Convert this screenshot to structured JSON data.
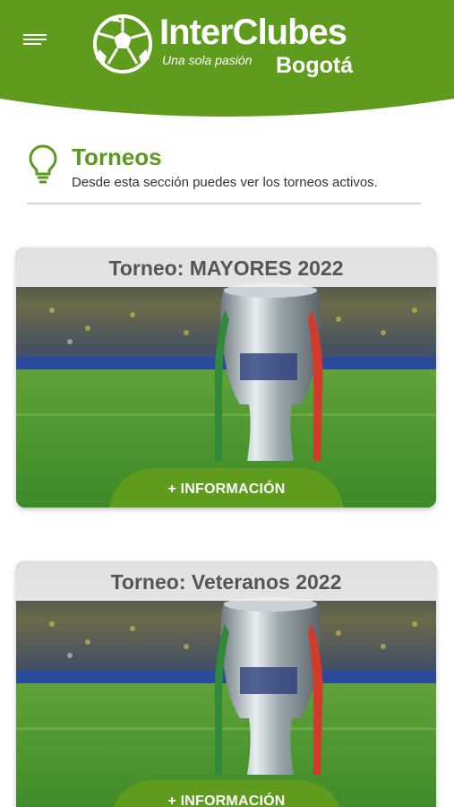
{
  "header": {
    "menu_icon": "hamburger-menu-icon",
    "brand_title": "InterClubes",
    "brand_slogan": "Una sola pasión",
    "brand_city": "Bogotá",
    "accent_color": "#5f9b1c"
  },
  "section": {
    "icon": "lightbulb-icon",
    "title": "Torneos",
    "description": "Desde esta sección puedes ver los torneos activos."
  },
  "tournaments": [
    {
      "title": "Torneo: MAYORES 2022",
      "button_label": "+ INFORMACIÓN",
      "image": "trophy-stadium-image"
    },
    {
      "title": "Torneo: Veteranos 2022",
      "button_label": "+ INFORMACIÓN",
      "image": "trophy-stadium-image"
    }
  ]
}
